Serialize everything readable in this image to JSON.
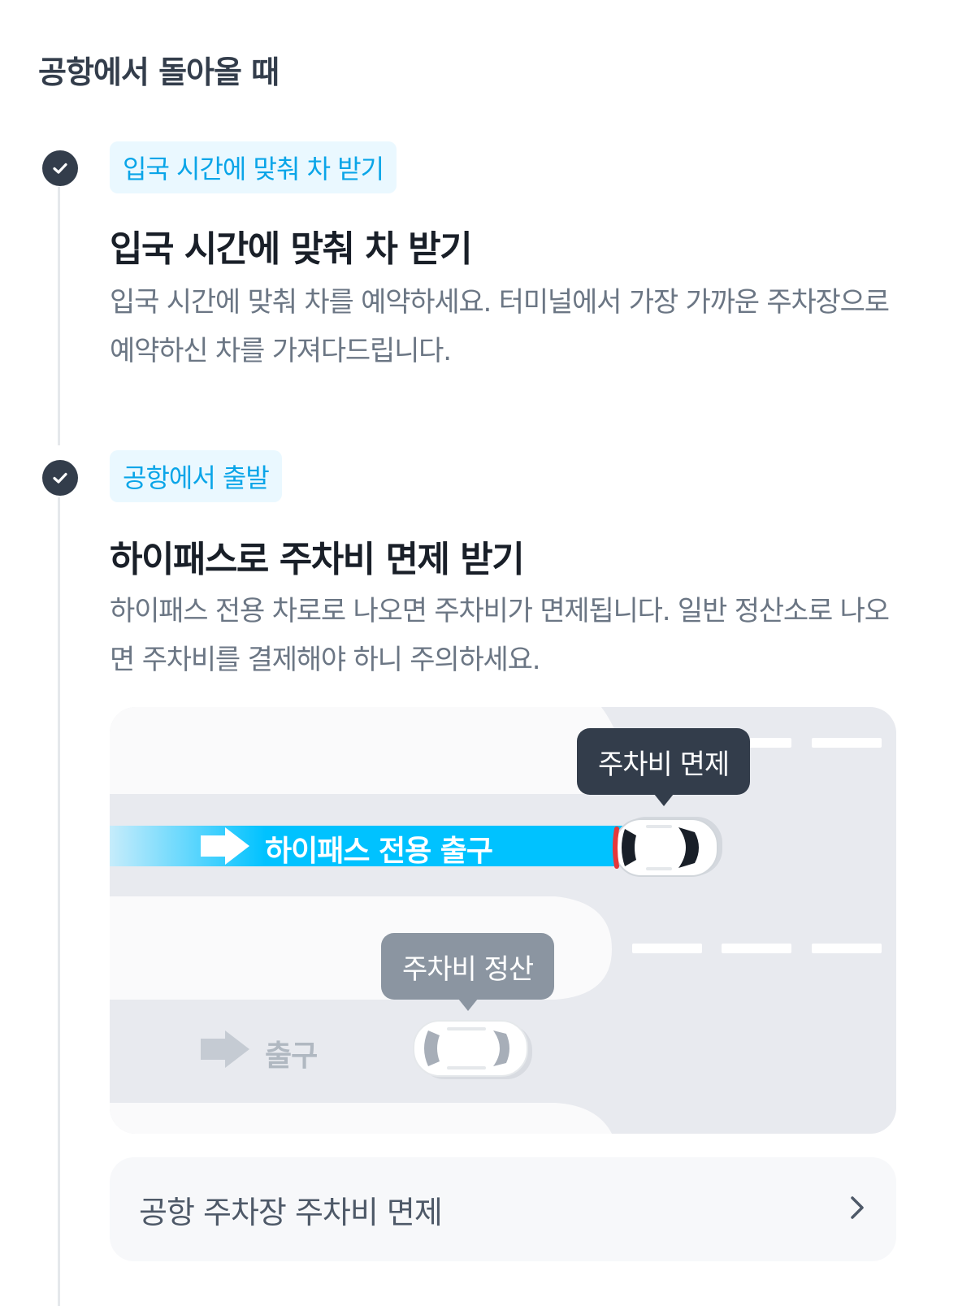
{
  "section": {
    "title": "공항에서 돌아올 때"
  },
  "steps": [
    {
      "tag": "입국 시간에 맞춰 차 받기",
      "title": "입국 시간에 맞춰 차 받기",
      "description": "입국 시간에 맞춰 차를 예약하세요. 터미널에서 가장 가까운 주차장으로 예약하신 차를 가져다드립니다."
    },
    {
      "tag": "공항에서 출발",
      "title": "하이패스로 주차비 면제 받기",
      "description": "하이패스 전용 차로로 나오면 주차비가 면제됩니다. 일반 정산소로 나오면 주차비를 결제해야 하니 주의하세요."
    }
  ],
  "illustration": {
    "hipass_bubble": "주차비 면제",
    "hipass_lane": "하이패스 전용 출구",
    "exit_bubble": "주차비 정산",
    "exit_lane": "출구"
  },
  "link_card": {
    "label": "공항 주차장 주차비 면제",
    "icon": "chevron-right-icon"
  },
  "colors": {
    "accent": "#0aa5e8",
    "hipass": "#00c2ff",
    "dark": "#333d4b",
    "muted": "#8b95a1"
  }
}
